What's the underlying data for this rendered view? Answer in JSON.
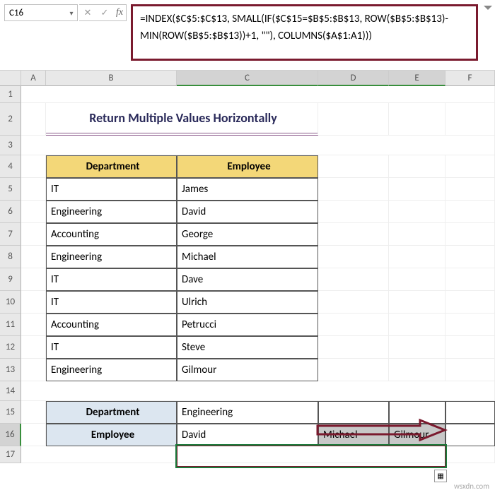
{
  "name_box": "C16",
  "formula": "=INDEX($C$5:$C$13, SMALL(IF($C$15=$B$5:$B$13, ROW($B$5:$B$13)-MIN(ROW($B$5:$B$13))+1, \"\"), COLUMNS($A$1:A1)))",
  "columns": [
    "",
    "A",
    "B",
    "C",
    "D",
    "E",
    "F"
  ],
  "title": "Return Multiple Values Horizontally",
  "table": {
    "headers": [
      "Department",
      "Employee"
    ],
    "rows": [
      [
        "IT",
        "James"
      ],
      [
        "Engineering",
        "David"
      ],
      [
        "Accounting",
        "George"
      ],
      [
        "Engineering",
        "Michael"
      ],
      [
        "IT",
        "Dave"
      ],
      [
        "IT",
        "Ulrich"
      ],
      [
        "Accounting",
        "Petrucci"
      ],
      [
        "IT",
        "Steve"
      ],
      [
        "Engineering",
        "Gilmour"
      ]
    ]
  },
  "lookup": {
    "dept_label": "Department",
    "dept_value": "Engineering",
    "emp_label": "Employee",
    "emp_results": [
      "David",
      "Michael",
      "Gilmour"
    ]
  },
  "watermark": "wsxdn.com",
  "icons": {
    "dropdown": "▾",
    "cancel": "✕",
    "check": "✓",
    "fx": "fx",
    "fill": "▦"
  }
}
